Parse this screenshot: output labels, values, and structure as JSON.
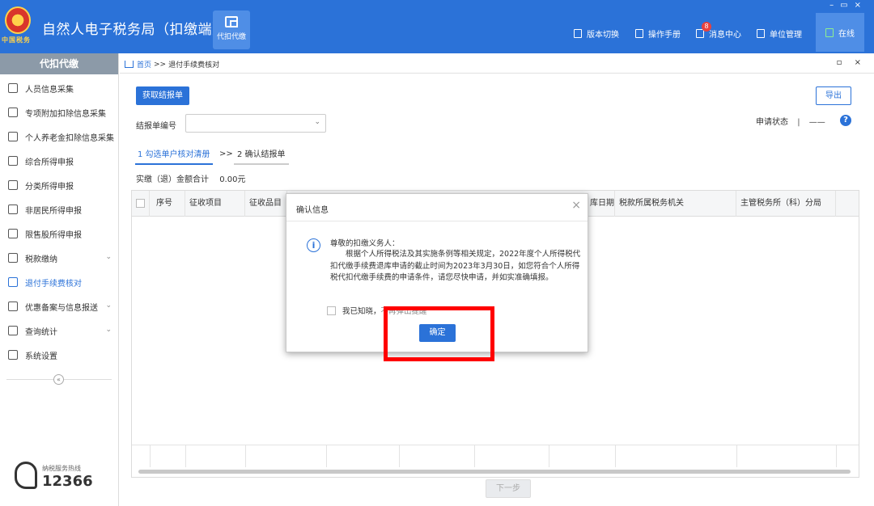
{
  "app": {
    "title": "自然人电子税务局（扣缴端）",
    "module_tile_label": "代扣代缴",
    "emblem_text": "中国税务"
  },
  "top_nav": [
    {
      "label": "版本切换",
      "icon": "switch-icon"
    },
    {
      "label": "操作手册",
      "icon": "manual-icon"
    },
    {
      "label": "消息中心",
      "icon": "message-icon",
      "badge": "8"
    },
    {
      "label": "单位管理",
      "icon": "building-icon"
    }
  ],
  "status": {
    "label": "在线",
    "icon": "monitor-icon"
  },
  "window_controls": [
    "–",
    "▭",
    "×"
  ],
  "sidebar": {
    "header": "代扣代缴",
    "items": [
      {
        "label": "人员信息采集",
        "icon": "person-icon"
      },
      {
        "label": "专项附加扣除信息采集",
        "icon": "list-icon"
      },
      {
        "label": "个人养老金扣除信息采集",
        "icon": "document-icon"
      },
      {
        "label": "综合所得申报",
        "icon": "layers-icon"
      },
      {
        "label": "分类所得申报",
        "icon": "pie-icon"
      },
      {
        "label": "非居民所得申报",
        "icon": "person-outline-icon"
      },
      {
        "label": "限售股所得申报",
        "icon": "bar-chart-icon"
      },
      {
        "label": "税款缴纳",
        "icon": "wallet-icon",
        "chevron": "⌄"
      },
      {
        "label": "退付手续费核对",
        "icon": "refund-icon",
        "active": true
      },
      {
        "label": "优惠备案与信息报送",
        "icon": "file-icon",
        "chevron": "⌄"
      },
      {
        "label": "查询统计",
        "icon": "query-icon",
        "chevron": "⌄"
      },
      {
        "label": "系统设置",
        "icon": "gear-icon"
      }
    ],
    "collapse_symbol": "«",
    "hotline_label": "纳税服务热线",
    "hotline_number": "12366"
  },
  "breadcrumb": {
    "home": "首页",
    "sep": ">>",
    "current": "退付手续费核对"
  },
  "tab_controls": "▫ ×",
  "toolbar": {
    "fetch_label": "获取结报单",
    "export_label": "导出"
  },
  "report_select": {
    "label": "结报单编号",
    "value": "",
    "caret": "⌄"
  },
  "apply_status": {
    "label": "申请状态",
    "value": "——",
    "help": "?"
  },
  "steps": {
    "step1": "1 勾选单户核对清册",
    "sep": ">>",
    "step2": "2 确认结报单"
  },
  "total": {
    "label": "实缴（退）金额合计",
    "value": "0.00元"
  },
  "table": {
    "headers": [
      "",
      "序号",
      "征收项目",
      "征收品目",
      "",
      "",
      "",
      "",
      "库日期",
      "税款所属税务机关",
      "主管税务所（科）分局"
    ]
  },
  "next_button": "下一步",
  "dialog": {
    "title": "确认信息",
    "close": "×",
    "info_symbol": "i",
    "greeting": "尊敬的扣缴义务人：",
    "body": "根据个人所得税法及其实施条例等相关规定，2022年度个人所得税代扣代缴手续费退库申请的截止时间为2023年3月30日，如您符合个人所得税代扣代缴手续费的申请条件，请您尽快申请，并如实准确填报。",
    "checkbox_label": "我已知晓，",
    "checkbox_label_tail": "不再弹出提醒",
    "ok_label": "确定"
  },
  "colors": {
    "brand": "#2b72d8",
    "sidebar_head": "#8c9aa8",
    "highlight": "#ff0000",
    "badge": "#e8413d"
  }
}
